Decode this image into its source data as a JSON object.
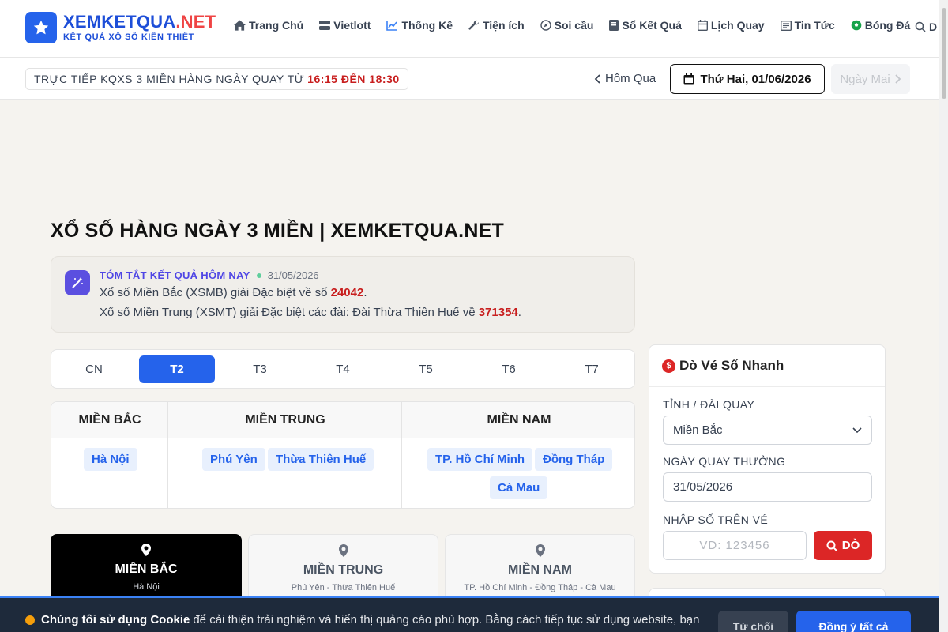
{
  "header": {
    "logo_part1": "XEMKETQUA",
    "logo_part2": ".NET",
    "logo_sub": "KẾT QUẢ XỔ SỐ KIẾN THIẾT",
    "nav": [
      {
        "label": "Trang Chủ",
        "icon": "home-icon"
      },
      {
        "label": "Vietlott",
        "icon": "server-icon"
      },
      {
        "label": "Thống Kê",
        "icon": "chart-line-icon"
      },
      {
        "label": "Tiện ích",
        "icon": "wrench-icon"
      },
      {
        "label": "Soi cầu",
        "icon": "compass-icon"
      },
      {
        "label": "Sổ Kết Quả",
        "icon": "book-icon"
      },
      {
        "label": "Lịch Quay",
        "icon": "calendar-icon"
      },
      {
        "label": "Tin Tức",
        "icon": "newspaper-icon"
      },
      {
        "label": "Bóng Đá",
        "icon": "soccer-ball-icon"
      }
    ],
    "search_partial": "D"
  },
  "subbar": {
    "live_text": "TRỰC TIẾP KQXS 3 MIỀN HÀNG NGÀY QUAY TỪ",
    "live_time": "16:15 ĐẾN 18:30",
    "prev_label": "Hôm Qua",
    "date_label": "Thứ Hai, 01/06/2026",
    "next_label": "Ngày Mai"
  },
  "main": {
    "title": "XỔ SỐ HÀNG NGÀY 3 MIỀN | XEMKETQUA.NET",
    "summary": {
      "heading": "TÓM TẮT KẾT QUẢ HÔM NAY",
      "date": "31/05/2026",
      "line1_text": "Xổ số Miền Bắc (XSMB) giải Đặc biệt về số",
      "line1_num": "24042",
      "line2_text": "Xổ số Miền Trung (XSMT) giải Đặc biệt các đài: Đài Thừa Thiên Huế về",
      "line2_num": "371354"
    },
    "day_tabs": [
      "CN",
      "T2",
      "T3",
      "T4",
      "T5",
      "T6",
      "T7"
    ],
    "active_day": "T2",
    "regions": {
      "headers": [
        "MIỀN BẮC",
        "MIỀN TRUNG",
        "MIỀN NAM"
      ],
      "bac": [
        "Hà Nội"
      ],
      "trung": [
        "Phú Yên",
        "Thừa Thiên Huế"
      ],
      "nam": [
        "TP. Hồ Chí Minh",
        "Đồng Tháp",
        "Cà Mau"
      ]
    },
    "result_tabs": [
      {
        "name": "MIỀN BẮC",
        "sub": "Hà Nội"
      },
      {
        "name": "MIỀN TRUNG",
        "sub": "Phú Yên - Thừa Thiên Huế"
      },
      {
        "name": "MIỀN NAM",
        "sub": "TP. Hồ Chí Minh - Đồng Tháp - Cà Mau"
      }
    ]
  },
  "sidebar": {
    "title": "Dò Vé Số Nhanh",
    "province_label": "TỈNH / ĐÀI QUAY",
    "province_value": "Miền Bắc",
    "date_label": "NGÀY QUAY THƯỞNG",
    "date_value": "31/05/2026",
    "number_label": "NHẬP SỐ TRÊN VÉ",
    "number_placeholder": "VD: 123456",
    "check_button": "DÒ"
  },
  "cookie": {
    "bold": "Chúng tôi sử dụng Cookie",
    "text": "để cải thiện trải nghiệm và hiển thị quảng cáo phù hợp. Bằng cách tiếp tục sử dụng website, bạn",
    "reject": "Từ chối",
    "accept": "Đồng ý tất cả"
  },
  "colors": {
    "primary": "#2563eb",
    "red": "#dc2626",
    "dark": "#111111"
  }
}
